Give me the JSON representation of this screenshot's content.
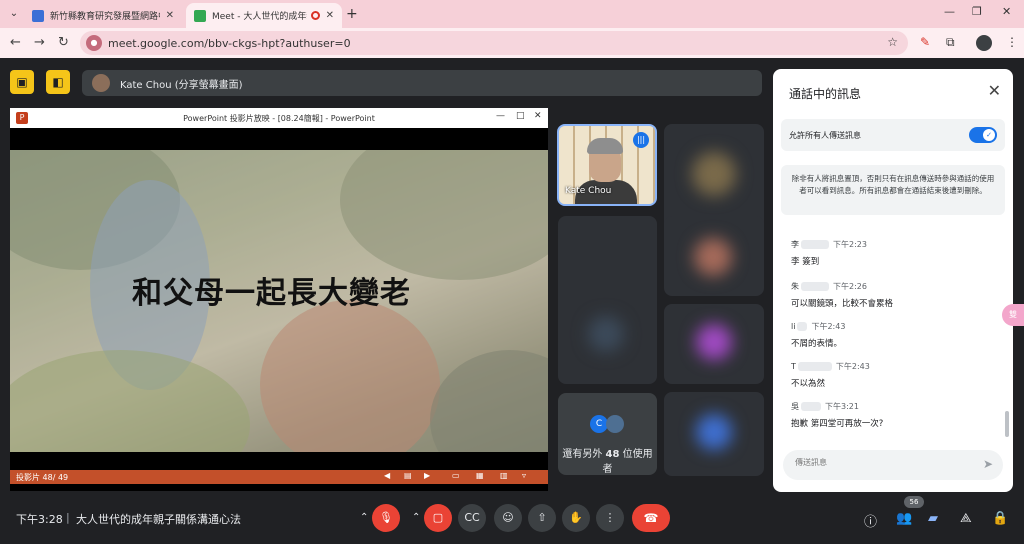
{
  "browser": {
    "tabs": [
      {
        "title": "新竹縣教育研究發展暨網路中心",
        "close": "✕",
        "favicon_color": "#3b6fd6"
      },
      {
        "title": "Meet - 大人世代的成年親子",
        "close": "✕",
        "favicon_color": "#34a853"
      }
    ],
    "new_tab": "+",
    "url": "meet.google.com/bbv-ckgs-hpt?authuser=0"
  },
  "meet": {
    "presenter_label": "Kate Chou (分享螢幕畫面)",
    "ppt_window_title": "PowerPoint 投影片放映 - [08.24簡報] - PowerPoint",
    "slide_text": "和父母一起長大變老",
    "slide_counter": "投影片 48/ 49",
    "self_name": "Kate Chou",
    "more_participants_prefix": "還有另外 ",
    "more_participants_count": "48",
    "more_participants_suffix": " 位使用者",
    "more_avatar_letter": "C"
  },
  "chat": {
    "title": "通話中的訊息",
    "allow_label": "允許所有人傳送訊息",
    "notice": "除非有人將訊息置頂，否則只有在訊息傳送時參與通話的使用者可以看到訊息。所有訊息都會在通話結束後遭到刪除。",
    "messages": [
      {
        "name": "李",
        "time": "下午2:23",
        "text": "李      簽到"
      },
      {
        "name": "朱",
        "time": "下午2:26",
        "text": "可以關鏡頭，比較不會累格"
      },
      {
        "name": "li",
        "time": "下午2:43",
        "text": "不屑的表情。"
      },
      {
        "name": "T",
        "time": "下午2:43",
        "text": "不以為然"
      },
      {
        "name": "吳",
        "time": "下午3:21",
        "text": "抱歉 第四堂可再放一次?"
      }
    ],
    "input_placeholder": "傳送訊息"
  },
  "bottom": {
    "time": "下午3:28",
    "meeting_name": "大人世代的成年親子關係溝通心法",
    "participants_count": "56"
  },
  "side_pill": "雙"
}
